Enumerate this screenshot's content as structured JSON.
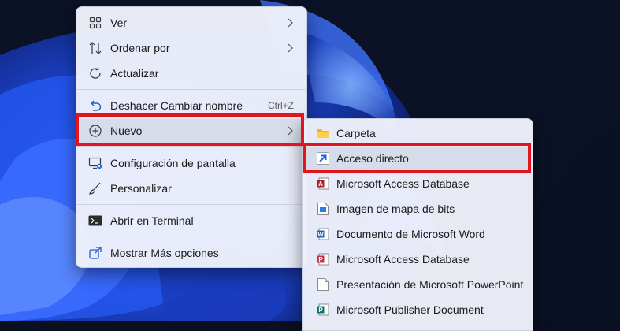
{
  "context_menu": {
    "items": [
      {
        "label": "Ver",
        "has_submenu": true
      },
      {
        "label": "Ordenar por",
        "has_submenu": true
      },
      {
        "label": "Actualizar"
      },
      {
        "label": "Deshacer Cambiar nombre",
        "shortcut": "Ctrl+Z"
      },
      {
        "label": "Nuevo",
        "has_submenu": true,
        "highlighted": true
      },
      {
        "label": "Configuración de pantalla"
      },
      {
        "label": "Personalizar"
      },
      {
        "label": "Abrir en Terminal"
      },
      {
        "label": "Mostrar Más opciones"
      }
    ]
  },
  "submenu_nuevo": {
    "items": [
      {
        "label": "Carpeta",
        "icon": "folder-icon"
      },
      {
        "label": "Acceso directo",
        "icon": "shortcut-arrow-icon",
        "highlighted": true
      },
      {
        "label": "Microsoft Access Database",
        "icon": "access-icon"
      },
      {
        "label": "Imagen de mapa de bits",
        "icon": "bitmap-icon"
      },
      {
        "label": "Documento de Microsoft Word",
        "icon": "word-icon"
      },
      {
        "label": "Microsoft Access Database",
        "icon": "access-icon"
      },
      {
        "label": "Presentación de Microsoft PowerPoint",
        "icon": "blank-document-icon"
      },
      {
        "label": "Microsoft Publisher Document",
        "icon": "publisher-icon"
      }
    ]
  },
  "colors": {
    "highlight_border": "#e3141d",
    "menu_background": "#eef1fa",
    "wallpaper_blue": "#1f4fe0"
  }
}
